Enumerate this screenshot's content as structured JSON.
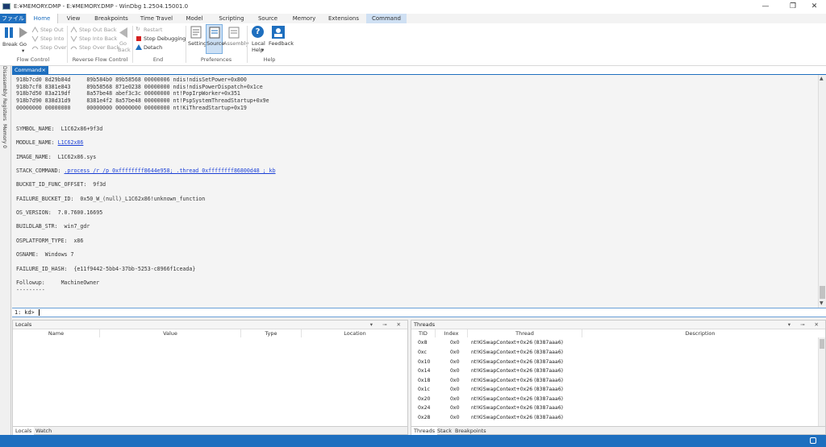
{
  "window": {
    "title": "E:¥MEMORY.DMP - E:¥MEMORY.DMP - WinDbg 1.2504.15001.0",
    "minimize": "—",
    "maximize": "❐",
    "close": "✕"
  },
  "tabs": [
    "ファイル",
    "Home",
    "View",
    "Breakpoints",
    "Time Travel",
    "Model",
    "Scripting",
    "Source",
    "Memory",
    "Extensions",
    "Command"
  ],
  "ribbon": {
    "flow": {
      "break": "Break",
      "go": "Go",
      "step_out": "Step Out",
      "step_into": "Step Into",
      "step_over": "Step Over",
      "group": "Flow Control"
    },
    "reverse": {
      "step_out_back": "Step Out Back",
      "step_into_back": "Step Into Back",
      "step_over_back": "Step Over Back",
      "go": "Go",
      "back": "Back",
      "group": "Reverse Flow Control"
    },
    "end": {
      "restart": "Restart",
      "stop": "Stop Debugging",
      "detach": "Detach",
      "group": "End"
    },
    "prefs": {
      "settings": "Settings",
      "source": "Source",
      "assembly": "Assembly",
      "group": "Preferences"
    },
    "help": {
      "local": "Local",
      "help": "Help",
      "feedback": "Feedback",
      "group": "Help"
    }
  },
  "sidebar": {
    "disassembly": "Disassembly",
    "registers": "Registers",
    "memory": "Memory 0"
  },
  "command": {
    "tab_label": "Command",
    "close": "×",
    "lines": [
      "918b7cd0 8d29b84d     89b584b0 89b58568 00000006 ndis!ndisSetPower+0x800",
      "918b7cf8 8381e843     89b58568 871e0238 00000000 ndis!ndisPowerDispatch+0x1ce",
      "918b7d50 83a219df     8a57be48 abef3c3c 00000000 nt!PopIrpWorker+0x351",
      "918b7d90 838d31d9     8381e4f2 8a57be48 00000000 nt!PspSystemThreadStartup+0x9e",
      "00000000 00000000     00000000 00000000 00000000 nt!KiThreadStartup+0x19",
      "",
      "",
      "SYMBOL_NAME:  L1C62x86+9f3d",
      "",
      "MODULE_NAME: ",
      "",
      "IMAGE_NAME:  L1C62x86.sys",
      "",
      "STACK_COMMAND: ",
      "",
      "BUCKET_ID_FUNC_OFFSET:  9f3d",
      "",
      "FAILURE_BUCKET_ID:  0x50_W_(null)_L1C62x86!unknown_function",
      "",
      "OS_VERSION:  7.0.7600.16695",
      "",
      "BUILDLAB_STR:  win7_gdr",
      "",
      "OSPLATFORM_TYPE:  x86",
      "",
      "OSNAME:  Windows 7",
      "",
      "FAILURE_ID_HASH:  {e11f9442-5bb4-37bb-5253-c8966f1ceada}",
      "",
      "Followup:     MachineOwner",
      "---------"
    ],
    "module_link": "L1C62x86",
    "stack_link": ".process /r /p 0xffffffff8644e958; .thread 0xffffffff86800d48 ; kb",
    "prompt": "1: kd> "
  },
  "locals": {
    "title": "Locals",
    "columns": [
      "Name",
      "Value",
      "Type",
      "Location"
    ],
    "tabs": [
      "Locals",
      "Watch"
    ]
  },
  "threads": {
    "title": "Threads",
    "columns": [
      "TID",
      "Index",
      "Thread",
      "Description"
    ],
    "rows": [
      [
        "0x8",
        "0x0",
        "nt!KiSwapContext+0x26 (8387aaa6)"
      ],
      [
        "0xc",
        "0x0",
        "nt!KiSwapContext+0x26 (8387aaa6)"
      ],
      [
        "0x10",
        "0x0",
        "nt!KiSwapContext+0x26 (8387aaa6)"
      ],
      [
        "0x14",
        "0x0",
        "nt!KiSwapContext+0x26 (8387aaa6)"
      ],
      [
        "0x18",
        "0x0",
        "nt!KiSwapContext+0x26 (8387aaa6)"
      ],
      [
        "0x1c",
        "0x0",
        "nt!KiSwapContext+0x26 (8387aaa6)"
      ],
      [
        "0x20",
        "0x0",
        "nt!KiSwapContext+0x26 (8387aaa6)"
      ],
      [
        "0x24",
        "0x0",
        "nt!KiSwapContext+0x26 (8387aaa6)"
      ],
      [
        "0x28",
        "0x0",
        "nt!KiSwapContext+0x26 (8387aaa6)"
      ]
    ],
    "tabs": [
      "Threads",
      "Stack",
      "Breakpoints"
    ]
  },
  "panel_buttons": "▾ ⊸ ✕",
  "colors": {
    "accent": "#1e6fbf",
    "link": "#1a3fd6",
    "stop": "#d42020"
  }
}
